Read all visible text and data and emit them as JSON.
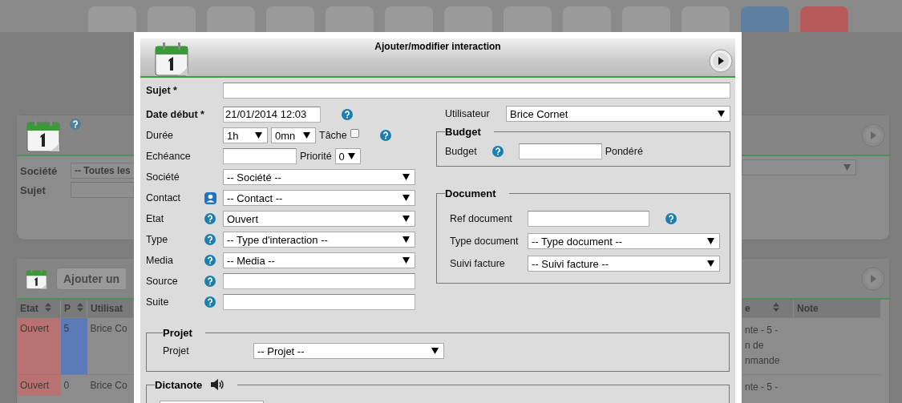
{
  "background": {
    "filter_panel": {
      "fields": [
        {
          "label": "Société",
          "value": "-- Toutes les"
        },
        {
          "label": "Sujet"
        }
      ]
    },
    "list_panel": {
      "add_button": "Ajouter un",
      "columns_left": [
        "Etat",
        "P",
        "Utilisat"
      ],
      "columns_right": [
        "e",
        "Note"
      ],
      "rows": [
        {
          "etat": {
            "text": "Ouvert",
            "color": "#b87272"
          },
          "p": {
            "text": "5",
            "color": "#5b7bb8"
          },
          "user": "Brice Co",
          "note_lines": [
            "nte - 5 -",
            "n de",
            "nmande"
          ]
        },
        {
          "etat": {
            "text": "Ouvert",
            "color": "#b87272"
          },
          "p": {
            "text": "0"
          },
          "user": "Brice Co",
          "note_lines": [
            "nte - 5 -"
          ]
        }
      ]
    }
  },
  "dialog": {
    "title": "Ajouter/modifier interaction",
    "subject": {
      "label": "Sujet *"
    },
    "left_rows": [
      {
        "label": "Date début *",
        "kind": "required",
        "controls": [
          {
            "kind": "input_date",
            "value": "21/01/2014 12:03"
          },
          {
            "kind": "help"
          }
        ]
      },
      {
        "label": "Durée",
        "kind": "plain",
        "controls": [
          {
            "kind": "select_small",
            "value": "1h"
          },
          {
            "kind": "select_small",
            "value": "0mn"
          },
          {
            "kind": "text",
            "value": "Tâche"
          },
          {
            "kind": "checkbox",
            "checked": false
          },
          {
            "kind": "help"
          }
        ]
      },
      {
        "label": "Echéance",
        "kind": "plain",
        "controls": [
          {
            "kind": "input_short"
          },
          {
            "kind": "text",
            "value": "Priorité"
          },
          {
            "kind": "select_tiny",
            "value": "0"
          }
        ]
      },
      {
        "label": "Société",
        "kind": "plain",
        "controls": [
          {
            "kind": "select",
            "value": "-- Société --"
          }
        ]
      },
      {
        "label": "Contact",
        "kind": "contact",
        "controls": [
          {
            "kind": "select",
            "value": "-- Contact --"
          }
        ]
      },
      {
        "label": "Etat",
        "kind": "help",
        "controls": [
          {
            "kind": "select",
            "value": "Ouvert"
          }
        ]
      },
      {
        "label": "Type",
        "kind": "help",
        "controls": [
          {
            "kind": "select",
            "value": "-- Type d'interaction --"
          }
        ]
      },
      {
        "label": "Media",
        "kind": "help",
        "controls": [
          {
            "kind": "select",
            "value": "-- Media --"
          }
        ]
      },
      {
        "label": "Source",
        "kind": "help",
        "controls": [
          {
            "kind": "input"
          }
        ]
      },
      {
        "label": "Suite",
        "kind": "help",
        "controls": [
          {
            "kind": "input"
          }
        ]
      }
    ],
    "user": {
      "label": "Utilisateur",
      "value": "Brice Cornet"
    },
    "budget": {
      "legend": "Budget",
      "label": "Budget",
      "suffix": "Pondéré"
    },
    "document": {
      "legend": "Document",
      "ref_label": "Ref document",
      "type_label": "Type document",
      "type_value": "-- Type document --",
      "invoice_label": "Suivi facture",
      "invoice_value": "-- Suivi facture --"
    },
    "project": {
      "legend": "Projet",
      "label": "Projet",
      "value": "-- Projet --"
    },
    "dictanote": {
      "legend": "Dictanote"
    }
  }
}
